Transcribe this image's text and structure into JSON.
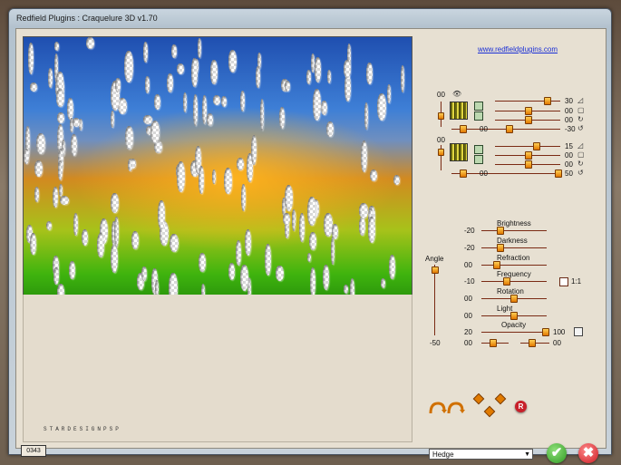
{
  "window": {
    "title": "Redfield Plugins : Craquelure 3D  v1.70"
  },
  "link": {
    "text": "www.redfieldplugins.com"
  },
  "signature": {
    "text": "STARDESIGNPSP"
  },
  "counter": {
    "text": "0343"
  },
  "light_panel": {
    "top_left_value": "00",
    "top_bottom_value": "00",
    "top_right_values": [
      "30",
      "00",
      "00",
      "-30"
    ],
    "bottom_left_value": "00",
    "bottom_bottom_value": "00",
    "bottom_right_values": [
      "15",
      "00",
      "00",
      "50"
    ]
  },
  "angle": {
    "label": "Angle",
    "value": "-50"
  },
  "sliders": [
    {
      "label": "Brightness",
      "value": "-20"
    },
    {
      "label": "Darkness",
      "value": "-20"
    },
    {
      "label": "Refraction",
      "value": "00"
    },
    {
      "label": "Frequency",
      "value": "-10"
    },
    {
      "label": "Rotation",
      "value": "00"
    },
    {
      "label": "Light",
      "value": "00"
    },
    {
      "label": "Opacity",
      "value": "20",
      "right_value": "100"
    }
  ],
  "ratio": {
    "label": "1:1"
  },
  "bottom_sliders": {
    "left": "00",
    "right": "00"
  },
  "preset": {
    "selected": "Hedge"
  },
  "colors": {
    "accent": "#e27800",
    "ok": "#3aa52a",
    "cancel": "#d8242c"
  }
}
